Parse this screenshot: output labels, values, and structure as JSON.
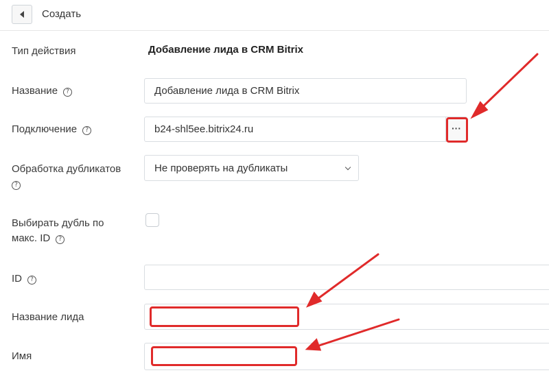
{
  "header": {
    "back_icon": "chevron-left-icon",
    "title": "Создать"
  },
  "form": {
    "action_type": {
      "label": "Тип действия",
      "value": "Добавление лида в CRM Bitrix"
    },
    "name": {
      "label": "Название",
      "help": "?",
      "value": "Добавление лида в CRM Bitrix"
    },
    "connection": {
      "label": "Подключение",
      "help": "?",
      "value": "b24-shl5ee.bitrix24.ru",
      "more_button": "···"
    },
    "duplicates": {
      "label": "Обработка дубликатов",
      "help": "?",
      "selected": "Не проверять на дубликаты"
    },
    "max_id": {
      "label_line1": "Выбирать дубль по",
      "label_line2": "макс. ID",
      "help": "?",
      "checked": false
    },
    "id": {
      "label": "ID",
      "help": "?",
      "value": ""
    },
    "lead_name": {
      "label": "Название лида",
      "value": ""
    },
    "first_name": {
      "label": "Имя",
      "value": ""
    }
  },
  "annotation_color": "#e02a2a"
}
